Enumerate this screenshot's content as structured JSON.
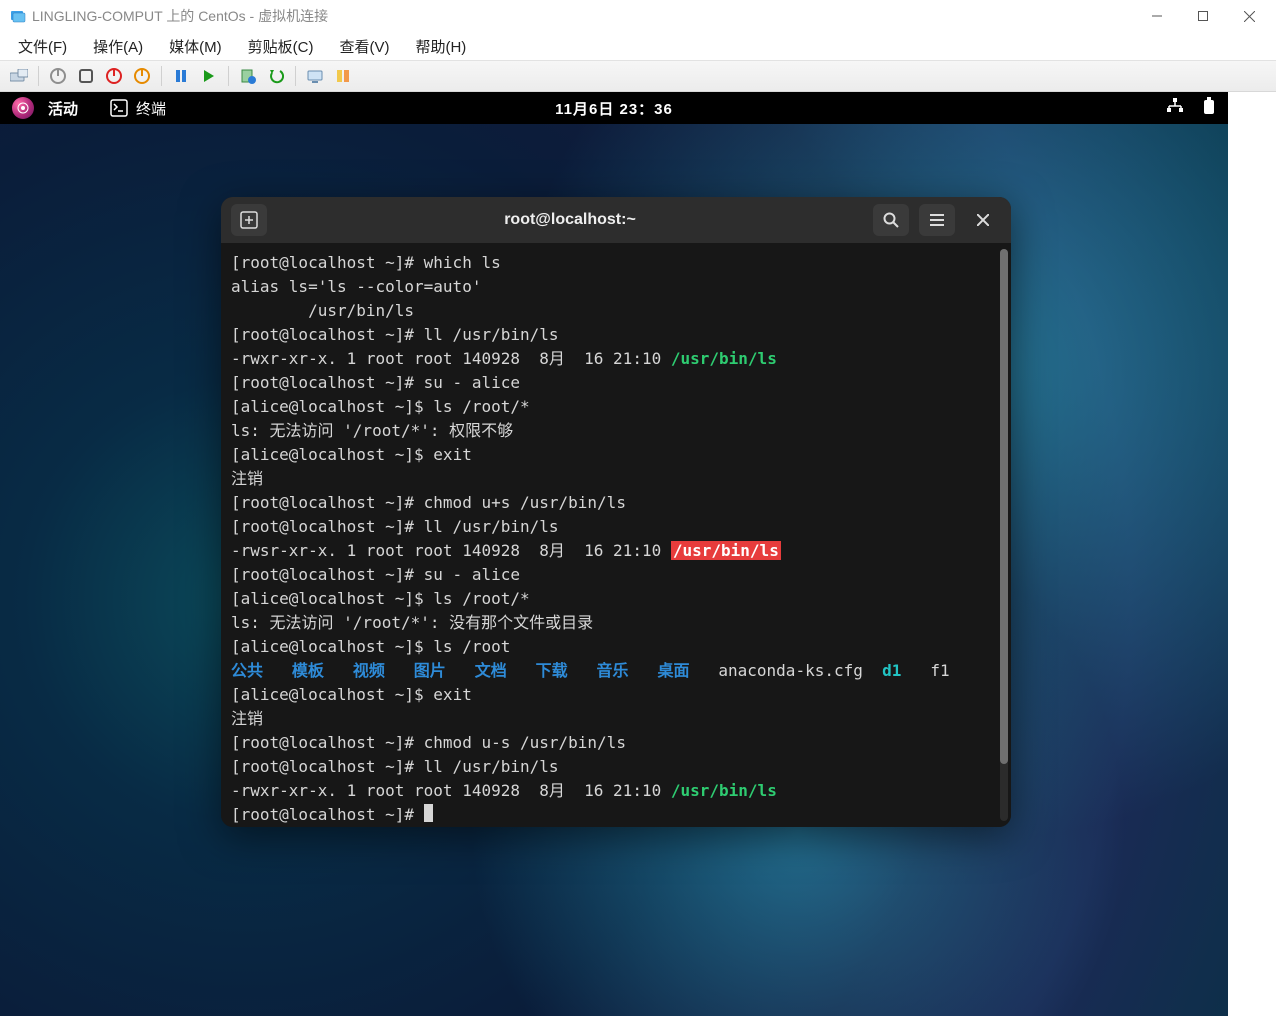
{
  "window": {
    "title": "LINGLING-COMPUT 上的 CentOs - 虚拟机连接"
  },
  "menus": {
    "file": "文件(F)",
    "action": "操作(A)",
    "media": "媒体(M)",
    "clipboard": "剪贴板(C)",
    "view": "查看(V)",
    "help": "帮助(H)"
  },
  "gnome": {
    "activities": "活动",
    "terminal_label": "终端",
    "clock": "11月6日 23：36"
  },
  "terminal": {
    "title": "root@localhost:~",
    "lines": {
      "l0_prompt": "[root@localhost ~]# ",
      "l0_cmd": "which ls",
      "l1": "alias ls='ls --color=auto'",
      "l2": "        /usr/bin/ls",
      "l3_prompt": "[root@localhost ~]# ",
      "l3_cmd": "ll /usr/bin/ls",
      "l4_a": "-rwxr-xr-x. 1 root root 140928  8月  16 21:10 ",
      "l4_b": "/usr/bin/ls",
      "l5_prompt": "[root@localhost ~]# ",
      "l5_cmd": "su - alice",
      "l6_prompt": "[alice@localhost ~]$ ",
      "l6_cmd": "ls /root/*",
      "l7": "ls: 无法访问 '/root/*': 权限不够",
      "l8_prompt": "[alice@localhost ~]$ ",
      "l8_cmd": "exit",
      "l9": "注销",
      "l10_prompt": "[root@localhost ~]# ",
      "l10_cmd": "chmod u+s /usr/bin/ls",
      "l11_prompt": "[root@localhost ~]# ",
      "l11_cmd": "ll /usr/bin/ls",
      "l12_a": "-rwsr-xr-x. 1 root root 140928  8月  16 21:10 ",
      "l12_b": "/usr/bin/ls",
      "l13_prompt": "[root@localhost ~]# ",
      "l13_cmd": "su - alice",
      "l14_prompt": "[alice@localhost ~]$ ",
      "l14_cmd": "ls /root/*",
      "l15": "ls: 无法访问 '/root/*': 没有那个文件或目录",
      "l16_prompt": "[alice@localhost ~]$ ",
      "l16_cmd": "ls /root",
      "l17_dirs": {
        "d0": "公共",
        "d1": "模板",
        "d2": "视频",
        "d3": "图片",
        "d4": "文档",
        "d5": "下载",
        "d6": "音乐",
        "d7": "桌面"
      },
      "l17_file1": "anaconda-ks.cfg",
      "l17_d1": "d1",
      "l17_f1": "f1",
      "l18_prompt": "[alice@localhost ~]$ ",
      "l18_cmd": "exit",
      "l19": "注销",
      "l20_prompt": "[root@localhost ~]# ",
      "l20_cmd": "chmod u-s /usr/bin/ls",
      "l21_prompt": "[root@localhost ~]# ",
      "l21_cmd": "ll /usr/bin/ls",
      "l22_a": "-rwxr-xr-x. 1 root root 140928  8月  16 21:10 ",
      "l22_b": "/usr/bin/ls",
      "l23_prompt": "[root@localhost ~]# "
    }
  }
}
